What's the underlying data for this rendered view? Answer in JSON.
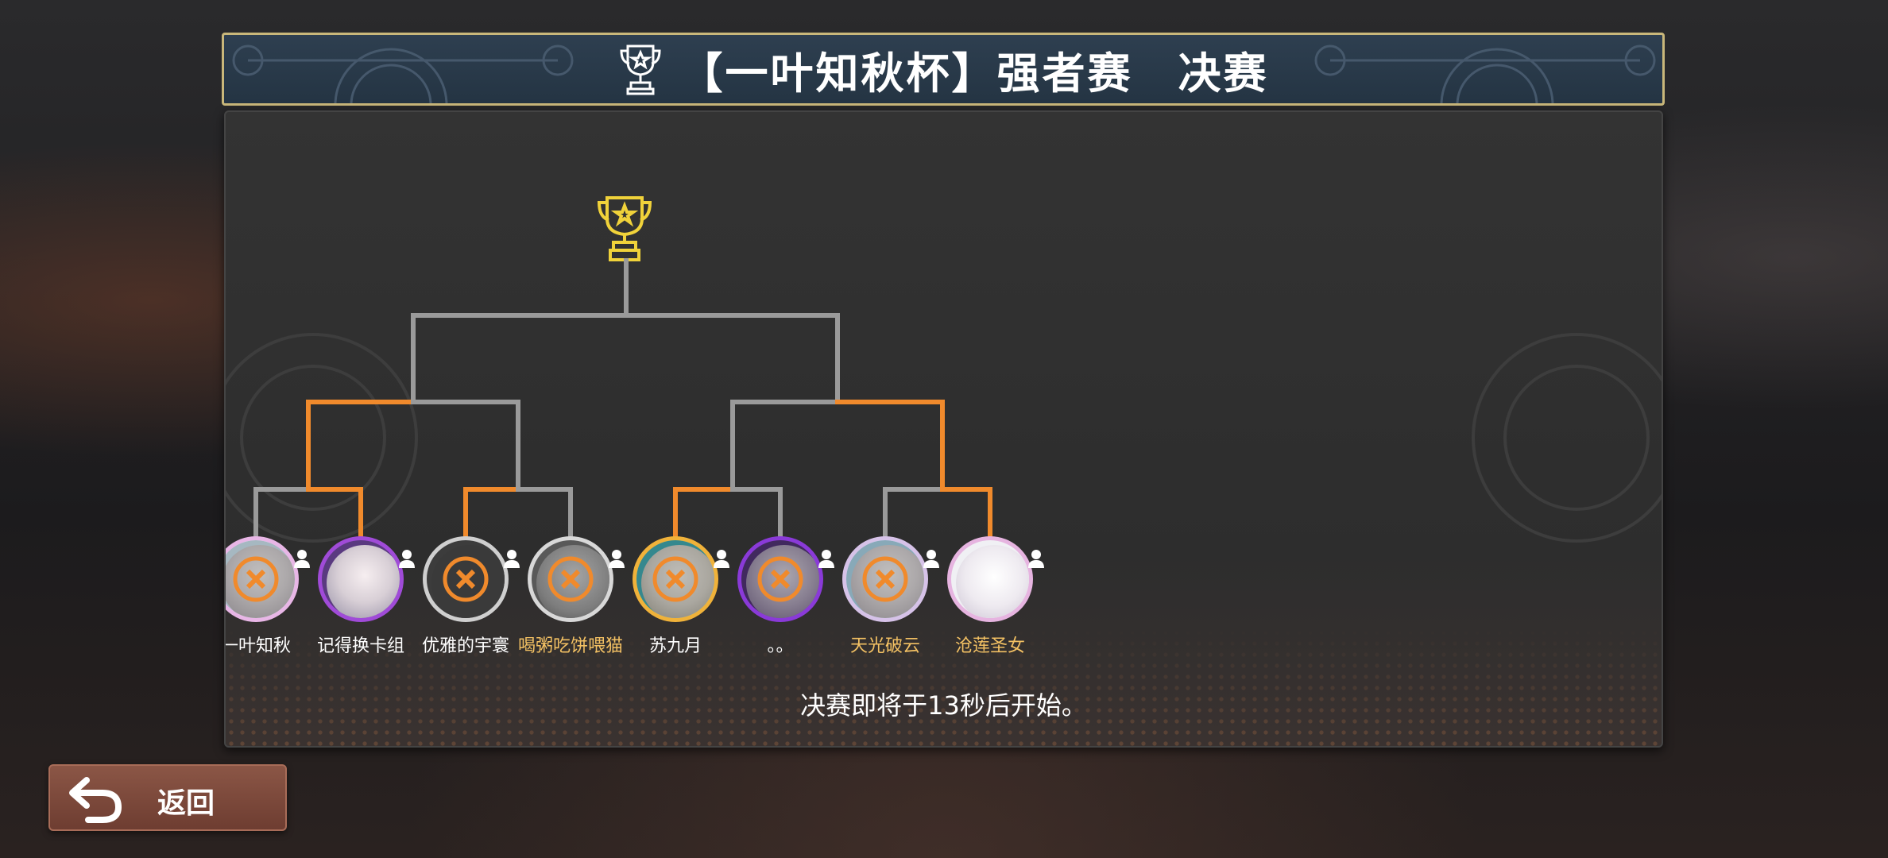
{
  "header": {
    "title": "【一叶知秋杯】强者赛　决赛"
  },
  "colors": {
    "accent_orange": "#f08a2c",
    "line_gray": "#9a9a9a",
    "trophy_gold": "#f0d23a",
    "back_button": "#7a4537"
  },
  "players": [
    {
      "name": "一叶知秋",
      "name_color": "white",
      "eliminated": true,
      "ring": "pink"
    },
    {
      "name": "记得换卡组",
      "name_color": "white",
      "eliminated": false,
      "ring": "purple"
    },
    {
      "name": "优雅的宇寰",
      "name_color": "white",
      "eliminated": true,
      "ring": "gray"
    },
    {
      "name": "喝粥吃饼喂猫",
      "name_color": "gold",
      "eliminated": true,
      "ring": "gray"
    },
    {
      "name": "苏九月",
      "name_color": "white",
      "eliminated": true,
      "ring": "gold"
    },
    {
      "name": "。。",
      "name_color": "white",
      "eliminated": true,
      "ring": "purple"
    },
    {
      "name": "天光破云",
      "name_color": "gold",
      "eliminated": true,
      "ring": "pink"
    },
    {
      "name": "沧莲圣女",
      "name_color": "gold",
      "eliminated": false,
      "ring": "pink"
    }
  ],
  "status_text": "决赛即将于13秒后开始。",
  "back_button": {
    "label": "返回"
  },
  "icons": {
    "header": "trophy-icon",
    "top": "trophy-icon",
    "eliminated": "x-mark-icon",
    "profile": "person-icon",
    "back": "back-arrow-icon"
  }
}
